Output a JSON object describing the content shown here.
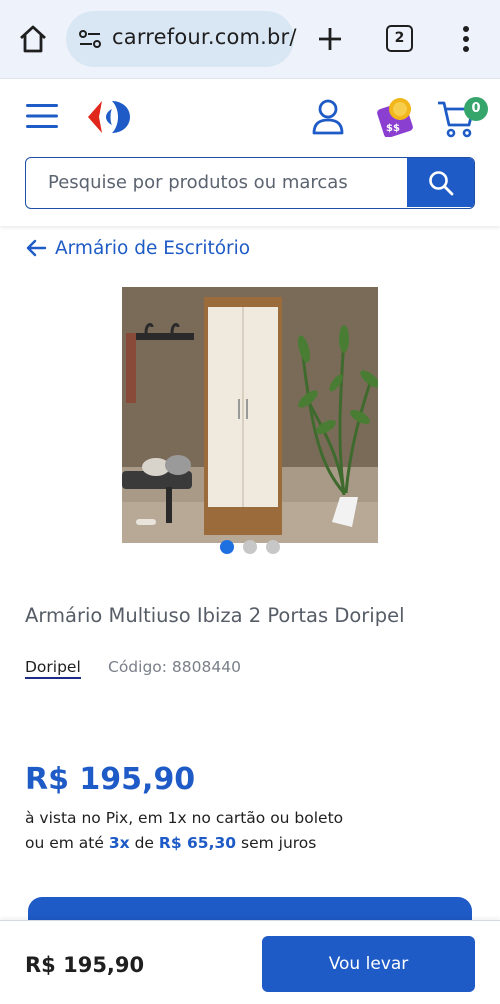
{
  "browser": {
    "url": "carrefour.com.br/",
    "tab_count": "2"
  },
  "header": {
    "cart_count": "0",
    "search_placeholder": "Pesquise por produtos ou marcas",
    "colors": {
      "accent": "#1e5bc6",
      "badge": "#36a56c"
    }
  },
  "breadcrumb": {
    "back_label": "Armário de Escritório"
  },
  "product": {
    "title": "Armário Multiuso Ibiza 2 Portas Doripel",
    "brand": "Doripel",
    "code": "Código: 8808440",
    "price": "R$ 195,90",
    "payment_line1": "à vista no Pix, em 1x no cartão ou boleto",
    "payment_prefix": "ou em até",
    "installments": "3x",
    "payment_middle": "de",
    "installment_value": "R$ 65,30",
    "payment_suffix": "sem juros",
    "image_count": 3,
    "image_active": 1
  },
  "bottom_bar": {
    "price": "R$ 195,90",
    "buy_label": "Vou levar"
  }
}
